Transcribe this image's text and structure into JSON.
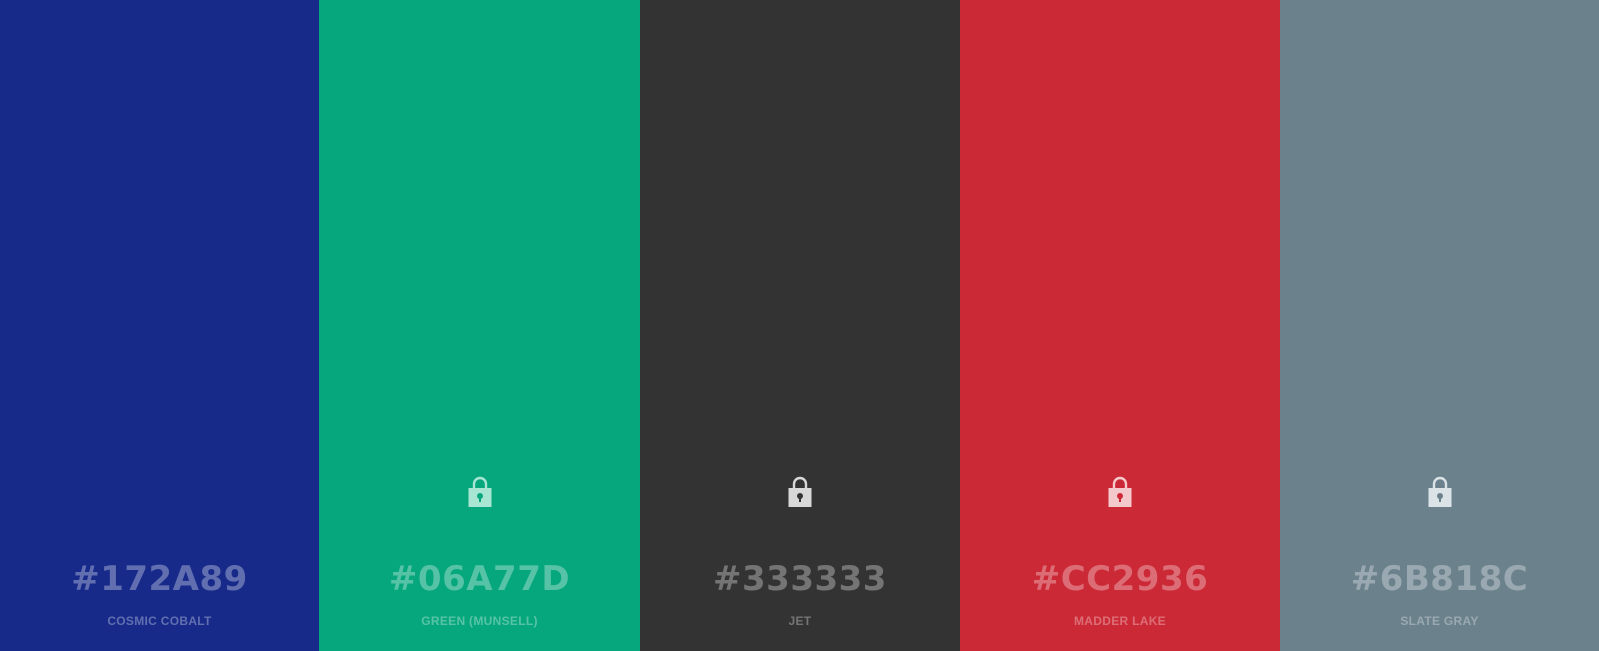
{
  "palette": {
    "colors": [
      {
        "hex": "#172A89",
        "name": "COSMIC COBALT",
        "bg": "#172A89",
        "locked": false
      },
      {
        "hex": "#06A77D",
        "name": "GREEN (MUNSELL)",
        "bg": "#06A77D",
        "locked": true
      },
      {
        "hex": "#333333",
        "name": "JET",
        "bg": "#333333",
        "locked": true
      },
      {
        "hex": "#CC2936",
        "name": "MADDER LAKE",
        "bg": "#CC2936",
        "locked": true
      },
      {
        "hex": "#6B818C",
        "name": "SLATE GRAY",
        "bg": "#6B818C",
        "locked": true
      }
    ]
  }
}
